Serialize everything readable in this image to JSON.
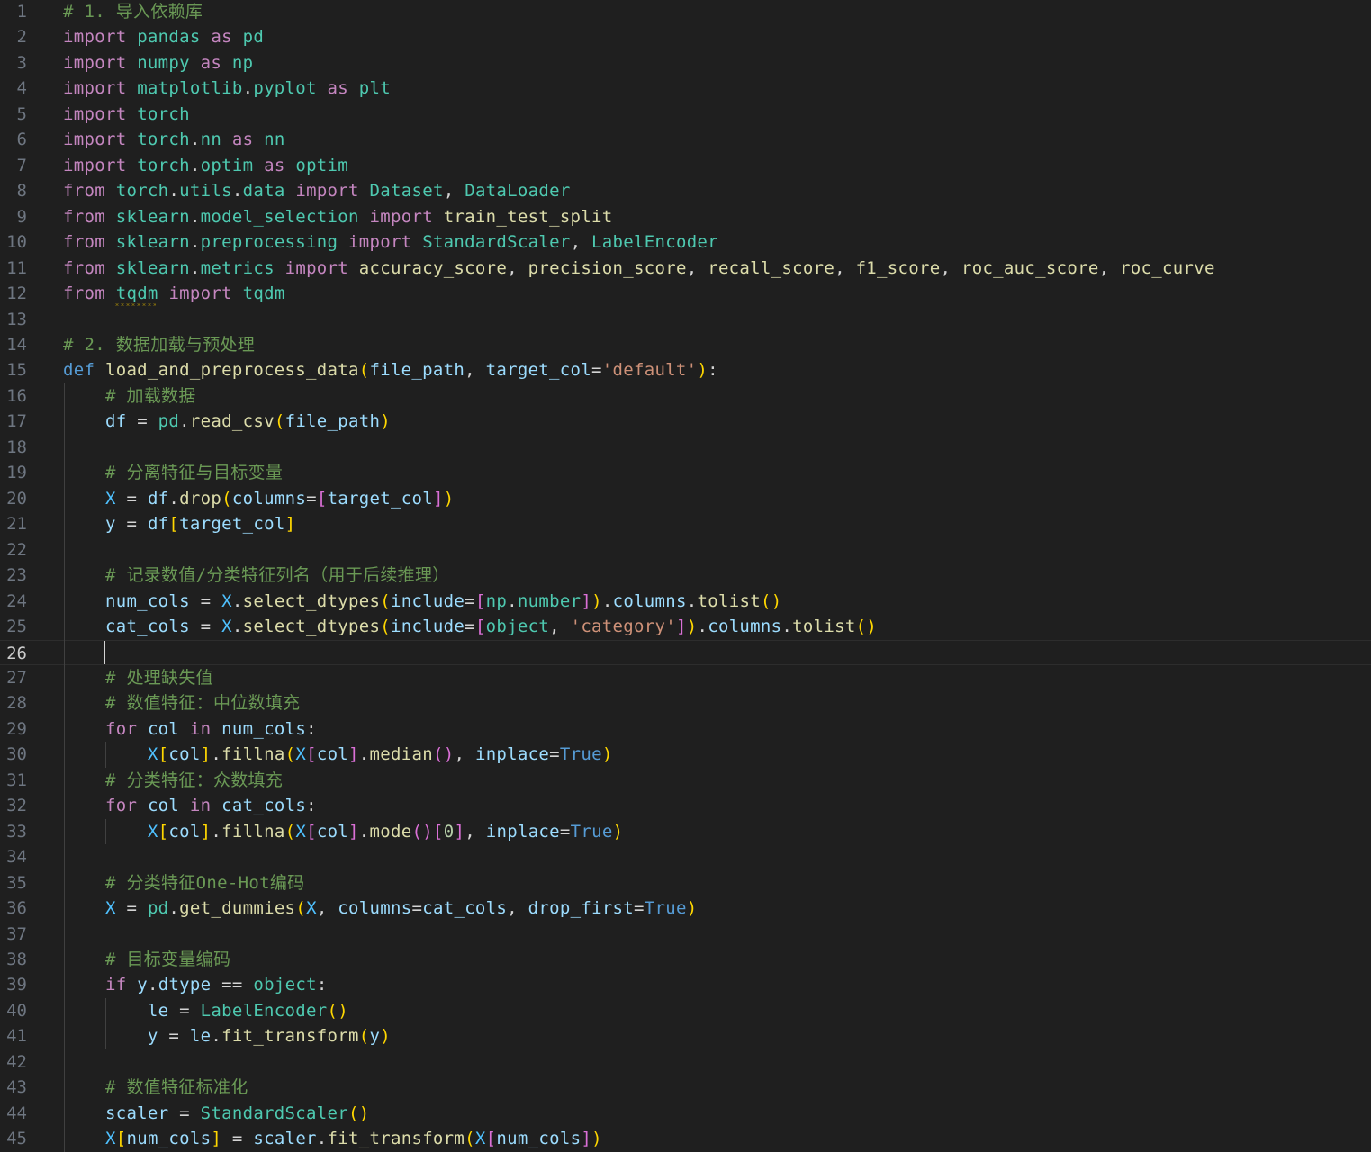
{
  "editor": {
    "active_line": 26,
    "colors": {
      "background": "#1f1f1f",
      "keyword": "#c586c0",
      "function": "#dcdcaa",
      "variable": "#9cdcfe",
      "class": "#4ec9b0",
      "string": "#ce9178",
      "comment": "#6a9955"
    },
    "lines": [
      [
        [
          "com",
          "# 1. 导入依赖库"
        ]
      ],
      [
        [
          "kw",
          "import"
        ],
        [
          "op",
          " "
        ],
        [
          "cls",
          "pandas"
        ],
        [
          "op",
          " "
        ],
        [
          "kw",
          "as"
        ],
        [
          "op",
          " "
        ],
        [
          "cls",
          "pd"
        ]
      ],
      [
        [
          "kw",
          "import"
        ],
        [
          "op",
          " "
        ],
        [
          "cls",
          "numpy"
        ],
        [
          "op",
          " "
        ],
        [
          "kw",
          "as"
        ],
        [
          "op",
          " "
        ],
        [
          "cls",
          "np"
        ]
      ],
      [
        [
          "kw",
          "import"
        ],
        [
          "op",
          " "
        ],
        [
          "cls",
          "matplotlib"
        ],
        [
          "op",
          "."
        ],
        [
          "cls",
          "pyplot"
        ],
        [
          "op",
          " "
        ],
        [
          "kw",
          "as"
        ],
        [
          "op",
          " "
        ],
        [
          "cls",
          "plt"
        ]
      ],
      [
        [
          "kw",
          "import"
        ],
        [
          "op",
          " "
        ],
        [
          "cls",
          "torch"
        ]
      ],
      [
        [
          "kw",
          "import"
        ],
        [
          "op",
          " "
        ],
        [
          "cls",
          "torch"
        ],
        [
          "op",
          "."
        ],
        [
          "cls",
          "nn"
        ],
        [
          "op",
          " "
        ],
        [
          "kw",
          "as"
        ],
        [
          "op",
          " "
        ],
        [
          "cls",
          "nn"
        ]
      ],
      [
        [
          "kw",
          "import"
        ],
        [
          "op",
          " "
        ],
        [
          "cls",
          "torch"
        ],
        [
          "op",
          "."
        ],
        [
          "cls",
          "optim"
        ],
        [
          "op",
          " "
        ],
        [
          "kw",
          "as"
        ],
        [
          "op",
          " "
        ],
        [
          "cls",
          "optim"
        ]
      ],
      [
        [
          "kw",
          "from"
        ],
        [
          "op",
          " "
        ],
        [
          "cls",
          "torch"
        ],
        [
          "op",
          "."
        ],
        [
          "cls",
          "utils"
        ],
        [
          "op",
          "."
        ],
        [
          "cls",
          "data"
        ],
        [
          "op",
          " "
        ],
        [
          "kw",
          "import"
        ],
        [
          "op",
          " "
        ],
        [
          "cls",
          "Dataset"
        ],
        [
          "op",
          ", "
        ],
        [
          "cls",
          "DataLoader"
        ]
      ],
      [
        [
          "kw",
          "from"
        ],
        [
          "op",
          " "
        ],
        [
          "cls",
          "sklearn"
        ],
        [
          "op",
          "."
        ],
        [
          "cls",
          "model_selection"
        ],
        [
          "op",
          " "
        ],
        [
          "kw",
          "import"
        ],
        [
          "op",
          " "
        ],
        [
          "fn",
          "train_test_split"
        ]
      ],
      [
        [
          "kw",
          "from"
        ],
        [
          "op",
          " "
        ],
        [
          "cls",
          "sklearn"
        ],
        [
          "op",
          "."
        ],
        [
          "cls",
          "preprocessing"
        ],
        [
          "op",
          " "
        ],
        [
          "kw",
          "import"
        ],
        [
          "op",
          " "
        ],
        [
          "cls",
          "StandardScaler"
        ],
        [
          "op",
          ", "
        ],
        [
          "cls",
          "LabelEncoder"
        ]
      ],
      [
        [
          "kw",
          "from"
        ],
        [
          "op",
          " "
        ],
        [
          "cls",
          "sklearn"
        ],
        [
          "op",
          "."
        ],
        [
          "cls",
          "metrics"
        ],
        [
          "op",
          " "
        ],
        [
          "kw",
          "import"
        ],
        [
          "op",
          " "
        ],
        [
          "fn",
          "accuracy_score"
        ],
        [
          "op",
          ", "
        ],
        [
          "fn",
          "precision_score"
        ],
        [
          "op",
          ", "
        ],
        [
          "fn",
          "recall_score"
        ],
        [
          "op",
          ", "
        ],
        [
          "fn",
          "f1_score"
        ],
        [
          "op",
          ", "
        ],
        [
          "fn",
          "roc_auc_score"
        ],
        [
          "op",
          ", "
        ],
        [
          "fn",
          "roc_curve"
        ]
      ],
      [
        [
          "kw",
          "from"
        ],
        [
          "op",
          " "
        ],
        [
          "cls",
          "tqdm"
        ],
        [
          "op",
          " "
        ],
        [
          "kw",
          "import"
        ],
        [
          "op",
          " "
        ],
        [
          "cls",
          "tqdm"
        ]
      ],
      [],
      [
        [
          "com",
          "# 2. 数据加载与预处理"
        ]
      ],
      [
        [
          "def",
          "def"
        ],
        [
          "op",
          " "
        ],
        [
          "fn",
          "load_and_preprocess_data"
        ],
        [
          "b1",
          "("
        ],
        [
          "var",
          "file_path"
        ],
        [
          "op",
          ", "
        ],
        [
          "var",
          "target_col"
        ],
        [
          "op",
          "="
        ],
        [
          "str",
          "'default'"
        ],
        [
          "b1",
          ")"
        ],
        [
          "op",
          ":"
        ]
      ],
      [
        [
          "op",
          "    "
        ],
        [
          "com",
          "# 加载数据"
        ]
      ],
      [
        [
          "op",
          "    "
        ],
        [
          "var",
          "df"
        ],
        [
          "op",
          " = "
        ],
        [
          "cls",
          "pd"
        ],
        [
          "op",
          "."
        ],
        [
          "fn",
          "read_csv"
        ],
        [
          "b1",
          "("
        ],
        [
          "var",
          "file_path"
        ],
        [
          "b1",
          ")"
        ]
      ],
      [],
      [
        [
          "op",
          "    "
        ],
        [
          "com",
          "# 分离特征与目标变量"
        ]
      ],
      [
        [
          "op",
          "    "
        ],
        [
          "const",
          "X"
        ],
        [
          "op",
          " = "
        ],
        [
          "var",
          "df"
        ],
        [
          "op",
          "."
        ],
        [
          "fn",
          "drop"
        ],
        [
          "b1",
          "("
        ],
        [
          "var",
          "columns"
        ],
        [
          "op",
          "="
        ],
        [
          "b2",
          "["
        ],
        [
          "var",
          "target_col"
        ],
        [
          "b2",
          "]"
        ],
        [
          "b1",
          ")"
        ]
      ],
      [
        [
          "op",
          "    "
        ],
        [
          "var",
          "y"
        ],
        [
          "op",
          " = "
        ],
        [
          "var",
          "df"
        ],
        [
          "b1",
          "["
        ],
        [
          "var",
          "target_col"
        ],
        [
          "b1",
          "]"
        ]
      ],
      [],
      [
        [
          "op",
          "    "
        ],
        [
          "com",
          "# 记录数值/分类特征列名（用于后续推理）"
        ]
      ],
      [
        [
          "op",
          "    "
        ],
        [
          "var",
          "num_cols"
        ],
        [
          "op",
          " = "
        ],
        [
          "const",
          "X"
        ],
        [
          "op",
          "."
        ],
        [
          "fn",
          "select_dtypes"
        ],
        [
          "b1",
          "("
        ],
        [
          "var",
          "include"
        ],
        [
          "op",
          "="
        ],
        [
          "b2",
          "["
        ],
        [
          "cls",
          "np"
        ],
        [
          "op",
          "."
        ],
        [
          "cls",
          "number"
        ],
        [
          "b2",
          "]"
        ],
        [
          "b1",
          ")"
        ],
        [
          "op",
          "."
        ],
        [
          "var",
          "columns"
        ],
        [
          "op",
          "."
        ],
        [
          "fn",
          "tolist"
        ],
        [
          "b1",
          "()"
        ]
      ],
      [
        [
          "op",
          "    "
        ],
        [
          "var",
          "cat_cols"
        ],
        [
          "op",
          " = "
        ],
        [
          "const",
          "X"
        ],
        [
          "op",
          "."
        ],
        [
          "fn",
          "select_dtypes"
        ],
        [
          "b1",
          "("
        ],
        [
          "var",
          "include"
        ],
        [
          "op",
          "="
        ],
        [
          "b2",
          "["
        ],
        [
          "cls",
          "object"
        ],
        [
          "op",
          ", "
        ],
        [
          "str",
          "'category'"
        ],
        [
          "b2",
          "]"
        ],
        [
          "b1",
          ")"
        ],
        [
          "op",
          "."
        ],
        [
          "var",
          "columns"
        ],
        [
          "op",
          "."
        ],
        [
          "fn",
          "tolist"
        ],
        [
          "b1",
          "()"
        ]
      ],
      [
        [
          "op",
          "    "
        ]
      ],
      [
        [
          "op",
          "    "
        ],
        [
          "com",
          "# 处理缺失值"
        ]
      ],
      [
        [
          "op",
          "    "
        ],
        [
          "com",
          "# 数值特征：中位数填充"
        ]
      ],
      [
        [
          "op",
          "    "
        ],
        [
          "kw",
          "for"
        ],
        [
          "op",
          " "
        ],
        [
          "var",
          "col"
        ],
        [
          "op",
          " "
        ],
        [
          "kw",
          "in"
        ],
        [
          "op",
          " "
        ],
        [
          "var",
          "num_cols"
        ],
        [
          "op",
          ":"
        ]
      ],
      [
        [
          "op",
          "        "
        ],
        [
          "const",
          "X"
        ],
        [
          "b1",
          "["
        ],
        [
          "var",
          "col"
        ],
        [
          "b1",
          "]"
        ],
        [
          "op",
          "."
        ],
        [
          "fn",
          "fillna"
        ],
        [
          "b1",
          "("
        ],
        [
          "const",
          "X"
        ],
        [
          "b2",
          "["
        ],
        [
          "var",
          "col"
        ],
        [
          "b2",
          "]"
        ],
        [
          "op",
          "."
        ],
        [
          "fn",
          "median"
        ],
        [
          "b2",
          "()"
        ],
        [
          "op",
          ", "
        ],
        [
          "var",
          "inplace"
        ],
        [
          "op",
          "="
        ],
        [
          "bool",
          "True"
        ],
        [
          "b1",
          ")"
        ]
      ],
      [
        [
          "op",
          "    "
        ],
        [
          "com",
          "# 分类特征：众数填充"
        ]
      ],
      [
        [
          "op",
          "    "
        ],
        [
          "kw",
          "for"
        ],
        [
          "op",
          " "
        ],
        [
          "var",
          "col"
        ],
        [
          "op",
          " "
        ],
        [
          "kw",
          "in"
        ],
        [
          "op",
          " "
        ],
        [
          "var",
          "cat_cols"
        ],
        [
          "op",
          ":"
        ]
      ],
      [
        [
          "op",
          "        "
        ],
        [
          "const",
          "X"
        ],
        [
          "b1",
          "["
        ],
        [
          "var",
          "col"
        ],
        [
          "b1",
          "]"
        ],
        [
          "op",
          "."
        ],
        [
          "fn",
          "fillna"
        ],
        [
          "b1",
          "("
        ],
        [
          "const",
          "X"
        ],
        [
          "b2",
          "["
        ],
        [
          "var",
          "col"
        ],
        [
          "b2",
          "]"
        ],
        [
          "op",
          "."
        ],
        [
          "fn",
          "mode"
        ],
        [
          "b2",
          "()"
        ],
        [
          "b2",
          "["
        ],
        [
          "num",
          "0"
        ],
        [
          "b2",
          "]"
        ],
        [
          "op",
          ", "
        ],
        [
          "var",
          "inplace"
        ],
        [
          "op",
          "="
        ],
        [
          "bool",
          "True"
        ],
        [
          "b1",
          ")"
        ]
      ],
      [],
      [
        [
          "op",
          "    "
        ],
        [
          "com",
          "# 分类特征One-Hot编码"
        ]
      ],
      [
        [
          "op",
          "    "
        ],
        [
          "const",
          "X"
        ],
        [
          "op",
          " = "
        ],
        [
          "cls",
          "pd"
        ],
        [
          "op",
          "."
        ],
        [
          "fn",
          "get_dummies"
        ],
        [
          "b1",
          "("
        ],
        [
          "const",
          "X"
        ],
        [
          "op",
          ", "
        ],
        [
          "var",
          "columns"
        ],
        [
          "op",
          "="
        ],
        [
          "var",
          "cat_cols"
        ],
        [
          "op",
          ", "
        ],
        [
          "var",
          "drop_first"
        ],
        [
          "op",
          "="
        ],
        [
          "bool",
          "True"
        ],
        [
          "b1",
          ")"
        ]
      ],
      [],
      [
        [
          "op",
          "    "
        ],
        [
          "com",
          "# 目标变量编码"
        ]
      ],
      [
        [
          "op",
          "    "
        ],
        [
          "kw",
          "if"
        ],
        [
          "op",
          " "
        ],
        [
          "var",
          "y"
        ],
        [
          "op",
          "."
        ],
        [
          "var",
          "dtype"
        ],
        [
          "op",
          " == "
        ],
        [
          "cls",
          "object"
        ],
        [
          "op",
          ":"
        ]
      ],
      [
        [
          "op",
          "        "
        ],
        [
          "var",
          "le"
        ],
        [
          "op",
          " = "
        ],
        [
          "cls",
          "LabelEncoder"
        ],
        [
          "b1",
          "()"
        ]
      ],
      [
        [
          "op",
          "        "
        ],
        [
          "var",
          "y"
        ],
        [
          "op",
          " = "
        ],
        [
          "var",
          "le"
        ],
        [
          "op",
          "."
        ],
        [
          "fn",
          "fit_transform"
        ],
        [
          "b1",
          "("
        ],
        [
          "var",
          "y"
        ],
        [
          "b1",
          ")"
        ]
      ],
      [],
      [
        [
          "op",
          "    "
        ],
        [
          "com",
          "# 数值特征标准化"
        ]
      ],
      [
        [
          "op",
          "    "
        ],
        [
          "var",
          "scaler"
        ],
        [
          "op",
          " = "
        ],
        [
          "cls",
          "StandardScaler"
        ],
        [
          "b1",
          "()"
        ]
      ],
      [
        [
          "op",
          "    "
        ],
        [
          "const",
          "X"
        ],
        [
          "b1",
          "["
        ],
        [
          "var",
          "num_cols"
        ],
        [
          "b1",
          "]"
        ],
        [
          "op",
          " = "
        ],
        [
          "var",
          "scaler"
        ],
        [
          "op",
          "."
        ],
        [
          "fn",
          "fit_transform"
        ],
        [
          "b1",
          "("
        ],
        [
          "const",
          "X"
        ],
        [
          "b2",
          "["
        ],
        [
          "var",
          "num_cols"
        ],
        [
          "b2",
          "]"
        ],
        [
          "b1",
          ")"
        ]
      ]
    ]
  }
}
